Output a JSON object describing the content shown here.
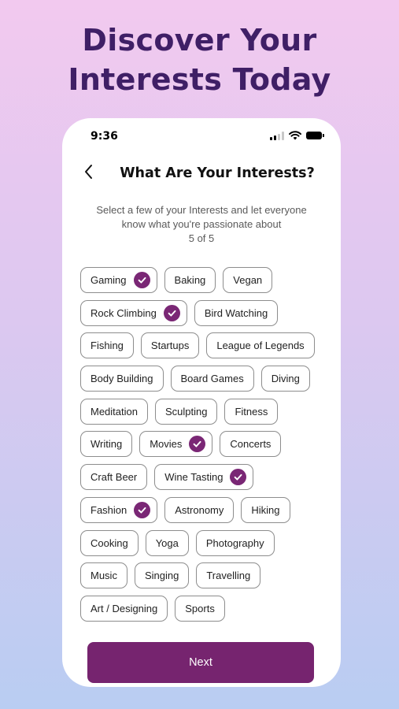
{
  "headline": {
    "line1": "Discover Your",
    "line2": "Interests Today"
  },
  "status_bar": {
    "time": "9:36"
  },
  "screen": {
    "title": "What Are Your Interests?",
    "subtitle_line1": "Select a few of your Interests and let everyone",
    "subtitle_line2": "know what you're passionate about",
    "counter": "5 of 5"
  },
  "interests": [
    [
      "Gaming",
      "Baking",
      "Vegan"
    ],
    [
      "Rock Climbing",
      "Bird Watching"
    ],
    [
      "Fishing",
      "Startups",
      "League of Legends"
    ],
    [
      "Body Building",
      "Board Games",
      "Diving"
    ],
    [
      "Meditation",
      "Sculpting",
      "Fitness"
    ],
    [
      "Writing",
      "Movies",
      "Concerts"
    ],
    [
      "Craft Beer",
      "Wine Tasting"
    ],
    [
      "Fashion",
      "Astronomy",
      "Hiking"
    ],
    [
      "Cooking",
      "Yoga",
      "Photography"
    ],
    [
      "Music",
      "Singing",
      "Travelling"
    ],
    [
      "Art / Designing",
      "Sports"
    ]
  ],
  "selected": [
    "Gaming",
    "Rock Climbing",
    "Movies",
    "Wine Tasting",
    "Fashion"
  ],
  "next_label": "Next",
  "colors": {
    "accent": "#76246f",
    "check": "#7a2775",
    "headline": "#3f1f66"
  },
  "icons": {
    "back": "chevron-left-icon",
    "selected": "check-circle-icon",
    "signal": "cellular-signal-icon",
    "wifi": "wifi-icon",
    "battery": "battery-icon"
  }
}
